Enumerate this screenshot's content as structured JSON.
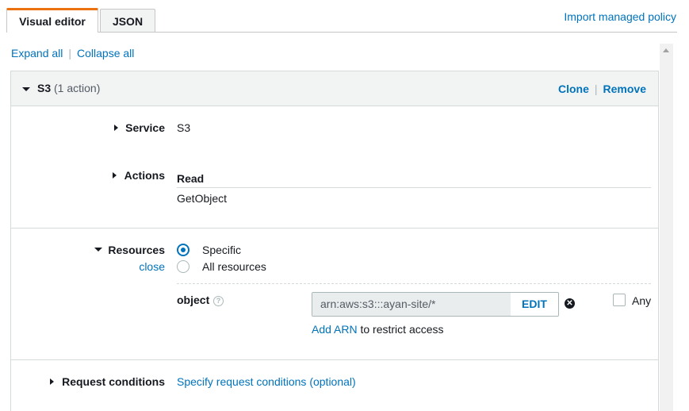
{
  "tabs": [
    {
      "label": "Visual editor",
      "active": true
    },
    {
      "label": "JSON",
      "active": false
    }
  ],
  "import_link": "Import managed policy",
  "expand_all": "Expand all",
  "collapse_all": "Collapse all",
  "statement": {
    "service_title": "S3",
    "action_count": "(1 action)",
    "clone": "Clone",
    "remove": "Remove",
    "service": {
      "label": "Service",
      "value": "S3"
    },
    "actions": {
      "label": "Actions",
      "group": "Read",
      "action": "GetObject"
    },
    "resources": {
      "label": "Resources",
      "close": "close",
      "options": [
        {
          "label": "Specific",
          "selected": true
        },
        {
          "label": "All resources",
          "selected": false
        }
      ],
      "object_label": "object",
      "arn_value": "arn:aws:s3:::ayan-site/*",
      "edit": "EDIT",
      "any_label": "Any",
      "add_arn": "Add ARN",
      "restrict_text": "to restrict access"
    },
    "request_conditions": {
      "label": "Request conditions",
      "link": "Specify request conditions (optional)"
    }
  },
  "colors": {
    "accent": "#ec7211",
    "link": "#0073bb"
  }
}
